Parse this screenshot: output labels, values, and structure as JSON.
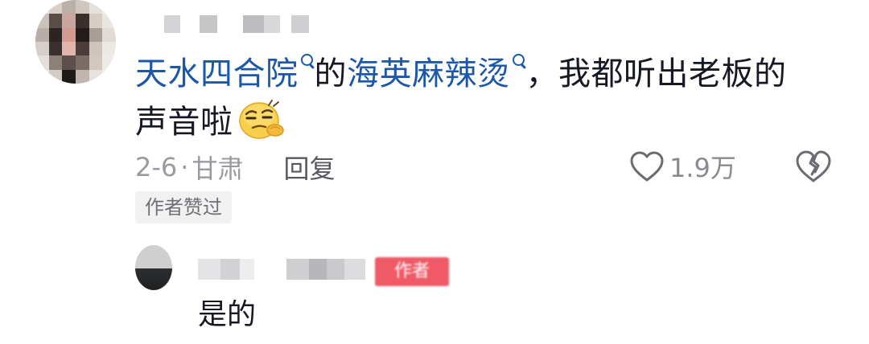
{
  "comment": {
    "avatar": "blurred-avatar",
    "username": "",
    "text": {
      "link1": "天水四合院",
      "mid": "的",
      "link2": "海英麻辣烫",
      "rest_line1": "，我都听出老板的",
      "rest_line2": "声音啦"
    },
    "emoji": "sly-smirk-emoji",
    "date": "2-6",
    "dot": "·",
    "location": "甘肃",
    "reply_label": "回复",
    "like_count": "1.9万",
    "author_liked_label": "作者赞过"
  },
  "reply": {
    "avatar": "blurred-avatar",
    "username": "",
    "badge": "作者",
    "text": "是的"
  },
  "colors": {
    "link": "#1d58a8",
    "text": "#161823",
    "meta": "#8a8b91",
    "badge_bg": "#f1f1f2",
    "author_badge": "#ef5a66"
  },
  "icons": {
    "search": "search-icon",
    "like": "heart-outline-icon",
    "dislike": "broken-heart-icon"
  }
}
